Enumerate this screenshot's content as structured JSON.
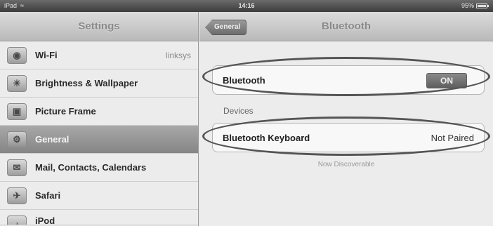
{
  "status_bar": {
    "device": "iPad",
    "wifi_icon": "wifi-icon",
    "time": "14:16",
    "battery_percent": "95%",
    "battery_level": 0.95
  },
  "left_pane": {
    "title": "Settings",
    "items": [
      {
        "label": "Wi-Fi",
        "value": "linksys",
        "icon": "wifi-settings-icon",
        "glyph": "◉"
      },
      {
        "label": "Brightness & Wallpaper",
        "value": "",
        "icon": "brightness-icon",
        "glyph": "☀"
      },
      {
        "label": "Picture Frame",
        "value": "",
        "icon": "picture-frame-icon",
        "glyph": "▣"
      },
      {
        "label": "General",
        "value": "",
        "icon": "gear-icon",
        "glyph": "⚙",
        "selected": true
      },
      {
        "label": "Mail, Contacts, Calendars",
        "value": "",
        "icon": "mail-icon",
        "glyph": "✉"
      },
      {
        "label": "Safari",
        "value": "",
        "icon": "safari-icon",
        "glyph": "✈"
      },
      {
        "label": "iPod",
        "value": "",
        "icon": "ipod-icon",
        "glyph": "♪"
      }
    ]
  },
  "right_pane": {
    "back_label": "General",
    "title": "Bluetooth",
    "bluetooth_row": {
      "label": "Bluetooth",
      "toggle": "ON"
    },
    "devices_label": "Devices",
    "device_row": {
      "label": "Bluetooth Keyboard",
      "value": "Not Paired"
    },
    "discoverable_text": "Now Discoverable"
  },
  "colors": {
    "annotation_oval": "#555555",
    "selected_row": "#8f8f8f"
  }
}
